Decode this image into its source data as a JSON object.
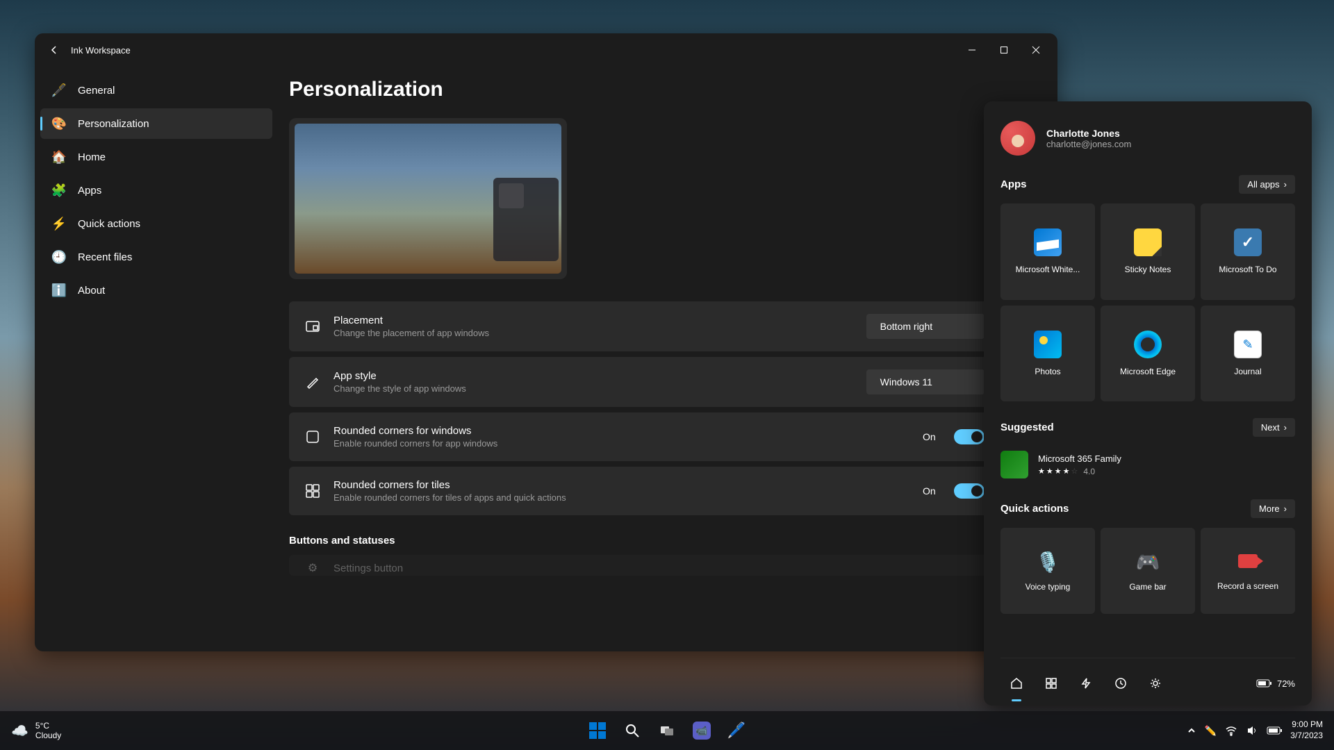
{
  "window": {
    "title": "Ink Workspace"
  },
  "sidebar": {
    "items": [
      {
        "icon": "🖋️",
        "label": "General"
      },
      {
        "icon": "🎨",
        "label": "Personalization"
      },
      {
        "icon": "🏠",
        "label": "Home"
      },
      {
        "icon": "🧩",
        "label": "Apps"
      },
      {
        "icon": "⚡",
        "label": "Quick actions"
      },
      {
        "icon": "🕘",
        "label": "Recent files"
      },
      {
        "icon": "ℹ️",
        "label": "About"
      }
    ]
  },
  "page": {
    "title": "Personalization",
    "settings": [
      {
        "title": "Placement",
        "desc": "Change the placement of app windows",
        "value": "Bottom right"
      },
      {
        "title": "App style",
        "desc": "Change the style of app windows",
        "value": "Windows 11"
      },
      {
        "title": "Rounded corners for windows",
        "desc": "Enable rounded corners for app windows",
        "state": "On"
      },
      {
        "title": "Rounded corners for tiles",
        "desc": "Enable rounded corners for tiles of apps and quick actions",
        "state": "On"
      }
    ],
    "section_header": "Buttons and statuses",
    "hidden_row": "Settings button"
  },
  "panel": {
    "user": {
      "name": "Charlotte Jones",
      "email": "charlotte@jones.com"
    },
    "apps_title": "Apps",
    "all_apps": "All apps",
    "apps": [
      {
        "label": "Microsoft White..."
      },
      {
        "label": "Sticky Notes"
      },
      {
        "label": "Microsoft To Do"
      },
      {
        "label": "Photos"
      },
      {
        "label": "Microsoft Edge"
      },
      {
        "label": "Journal"
      }
    ],
    "suggested_title": "Suggested",
    "next": "Next",
    "suggested": {
      "name": "Microsoft 365 Family",
      "rating": "4.0"
    },
    "quick_title": "Quick actions",
    "more": "More",
    "actions": [
      {
        "icon": "🎙️",
        "label": "Voice typing",
        "color": "#b060d0"
      },
      {
        "icon": "🎮",
        "label": "Game bar",
        "color": "#a0a0c0"
      },
      {
        "icon": "⬛",
        "label": "Record a screen",
        "color": "#e04040"
      }
    ],
    "battery": "72%"
  },
  "taskbar": {
    "temp": "5°C",
    "weather": "Cloudy",
    "time": "9:00 PM",
    "date": "3/7/2023"
  }
}
